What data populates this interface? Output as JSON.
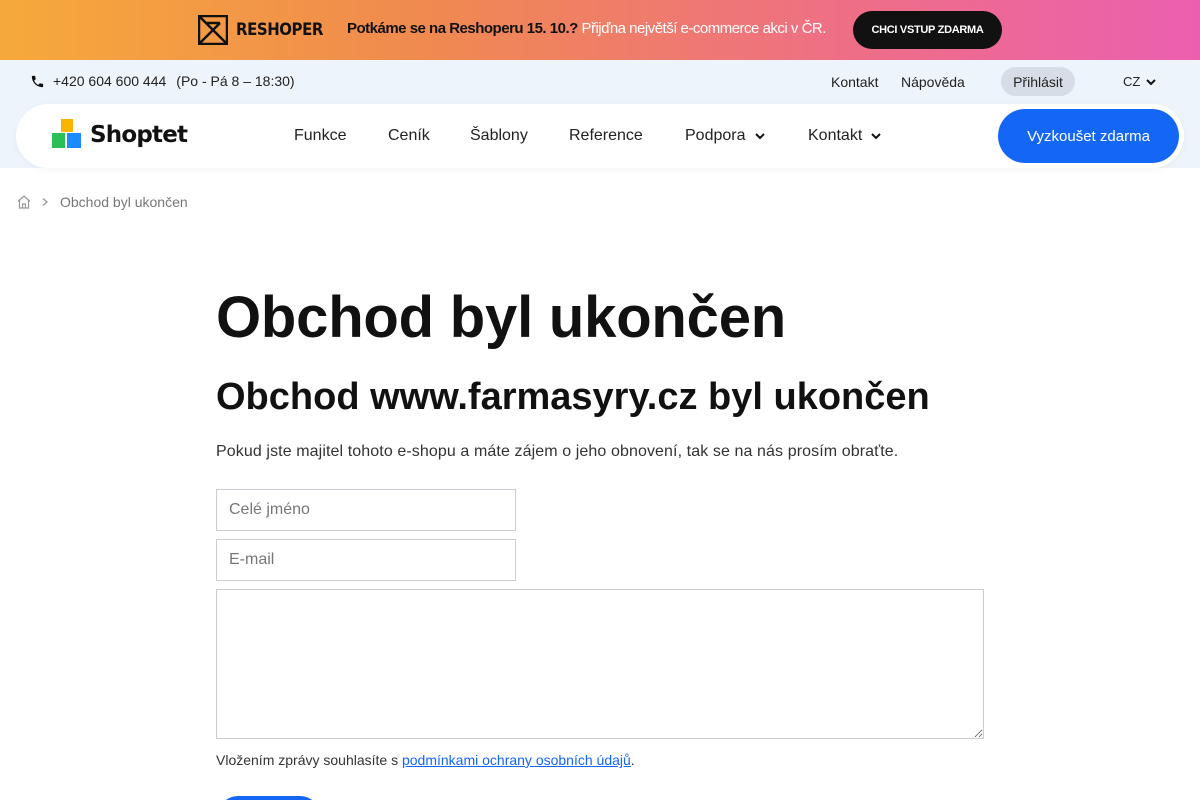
{
  "promo": {
    "brand": "RESHOPER",
    "text_bold": "Potkáme se na Reshoperu 15. 10.?",
    "text_light": " Přijďna největší e-commerce akci v ČR.",
    "cta": "CHCI VSTUP ZDARMA"
  },
  "utility": {
    "phone": "+420 604 600 444",
    "hours": "(Po - Pá 8 – 18:30)",
    "links": {
      "kontakt": "Kontakt",
      "napoveda": "Nápověda"
    },
    "login": "Přihlásit",
    "language": "CZ"
  },
  "nav": {
    "logo": "Shoptet",
    "items": {
      "funkce": "Funkce",
      "cenik": "Ceník",
      "sablony": "Šablony",
      "reference": "Reference",
      "podpora": "Podpora",
      "kontakt": "Kontakt"
    },
    "cta": "Vyzkoušet zdarma"
  },
  "breadcrumb": {
    "current": "Obchod byl ukončen"
  },
  "content": {
    "title": "Obchod byl ukončen",
    "subtitle": "Obchod www.farmasyry.cz byl ukončen",
    "lead": "Pokud jste majitel tohoto e-shopu a máte zájem o jeho obnovení, tak se na nás prosím obraťte."
  },
  "form": {
    "name_placeholder": "Celé jméno",
    "email_placeholder": "E-mail",
    "message_placeholder": "",
    "consent_prefix": "Vložením zprávy souhlasíte s ",
    "consent_link": "podmínkami ochrany osobních údajů",
    "consent_suffix": "."
  },
  "colors": {
    "primary": "#1466f5",
    "logo_yellow": "#f7b500",
    "logo_green": "#2bbf58",
    "logo_blue": "#1a8cff",
    "utility_bg": "#eef4fb"
  },
  "icons": {
    "phone": "phone-icon",
    "home": "home-icon",
    "chevron": "chevron-down-icon",
    "breadcrumb_separator": "chevron-right-icon"
  }
}
